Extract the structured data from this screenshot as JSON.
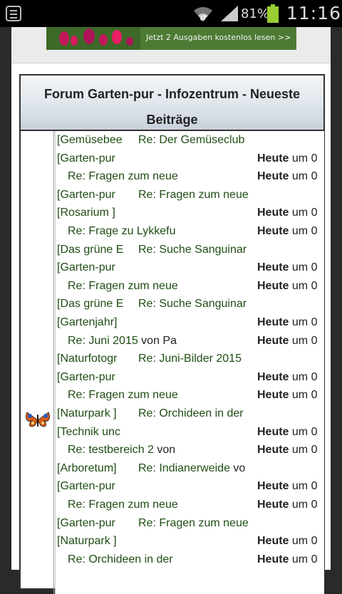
{
  "status_bar": {
    "battery_percent": "81%",
    "time": "11:16",
    "battery_level": 0.81,
    "icons": [
      "notification-list-icon",
      "wifi-icon",
      "signal-icon",
      "battery-icon"
    ]
  },
  "ad": {
    "cta_text": "Jetzt 2 Ausgaben kostenlos lesen >>"
  },
  "forum": {
    "title": "Forum Garten-pur - Infozentrum - Neueste Beiträge",
    "rows": [
      {
        "forum": "[Gemüsebee",
        "thread": "Re: Der Gemüseclub",
        "by": "",
        "today": "",
        "rest": ""
      },
      {
        "forum": "[Garten-pur",
        "thread": "",
        "by": "",
        "today": "Heute",
        "rest": " um 0"
      },
      {
        "forum": "",
        "thread": "Re: Fragen zum neue",
        "by": "",
        "today": "Heute",
        "rest": " um 0"
      },
      {
        "forum": "[Garten-pur",
        "thread": "Re: Fragen zum neue",
        "by": "",
        "today": "",
        "rest": ""
      },
      {
        "forum": "[Rosarium ]",
        "thread": "",
        "by": "",
        "today": "Heute",
        "rest": " um 0"
      },
      {
        "forum": "",
        "thread": "Re: Frage zu Lykkefu",
        "by": "",
        "today": "Heute",
        "rest": " um 0"
      },
      {
        "forum": "[Das grüne E",
        "thread": "Re: Suche Sanguinar",
        "by": "",
        "today": "",
        "rest": ""
      },
      {
        "forum": "[Garten-pur",
        "thread": "",
        "by": "",
        "today": "Heute",
        "rest": " um 0"
      },
      {
        "forum": "",
        "thread": "Re: Fragen zum neue",
        "by": "",
        "today": "Heute",
        "rest": " um 0"
      },
      {
        "forum": "[Das grüne E",
        "thread": "Re: Suche Sanguinar",
        "by": "",
        "today": "",
        "rest": ""
      },
      {
        "forum": "[Gartenjahr]",
        "thread": "",
        "by": "",
        "today": "Heute",
        "rest": " um 0"
      },
      {
        "forum": "",
        "thread": "Re: Juni 2015",
        "by": " von Pa",
        "today": "Heute",
        "rest": " um 0"
      },
      {
        "forum": "[Naturfotogr",
        "thread": "Re: Juni-Bilder 2015",
        "by": "",
        "today": "",
        "rest": ""
      },
      {
        "forum": "[Garten-pur",
        "thread": "",
        "by": "",
        "today": "Heute",
        "rest": " um 0"
      },
      {
        "forum": "",
        "thread": "Re: Fragen zum neue",
        "by": "",
        "today": "Heute",
        "rest": " um 0"
      },
      {
        "forum": "[Naturpark ]",
        "thread": "Re: Orchideen in der",
        "by": "",
        "today": "",
        "rest": ""
      },
      {
        "forum": "[Technik unc",
        "thread": "",
        "by": "",
        "today": "Heute",
        "rest": " um 0"
      },
      {
        "forum": "",
        "thread": "Re: testbereich 2",
        "by": " von",
        "today": "Heute",
        "rest": " um 0"
      },
      {
        "forum": "[Arboretum]",
        "thread": "Re: Indianerweide",
        "by": " vo",
        "today": "",
        "rest": ""
      },
      {
        "forum": "[Garten-pur",
        "thread": "",
        "by": "",
        "today": "Heute",
        "rest": " um 0"
      },
      {
        "forum": "",
        "thread": "Re: Fragen zum neue",
        "by": "",
        "today": "Heute",
        "rest": " um 0"
      },
      {
        "forum": "[Garten-pur",
        "thread": "Re: Fragen zum neue",
        "by": "",
        "today": "",
        "rest": ""
      },
      {
        "forum": "[Naturpark ]",
        "thread": "",
        "by": "",
        "today": "Heute",
        "rest": " um 0"
      },
      {
        "forum": "",
        "thread": "Re: Orchideen in der",
        "by": "",
        "today": "Heute",
        "rest": " um 0"
      }
    ]
  }
}
